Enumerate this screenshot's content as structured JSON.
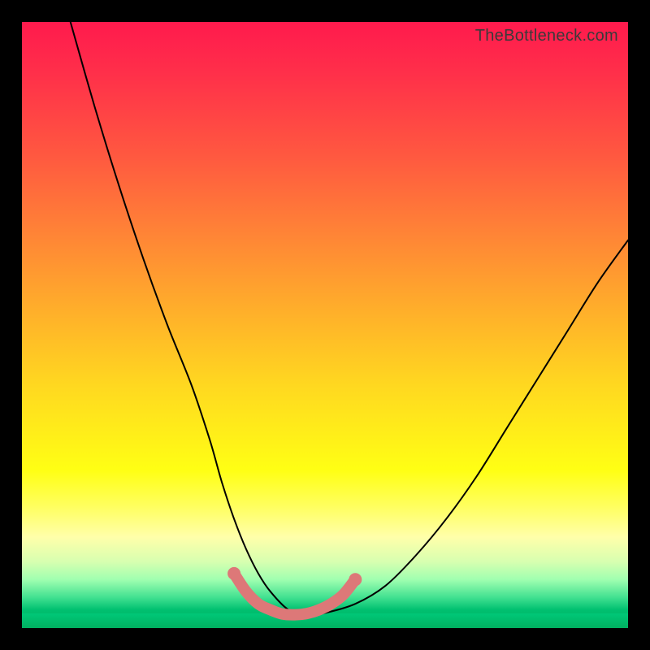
{
  "watermark": "TheBottleneck.com",
  "chart_data": {
    "type": "line",
    "title": "",
    "xlabel": "",
    "ylabel": "",
    "xlim": [
      0,
      100
    ],
    "ylim": [
      0,
      100
    ],
    "grid": false,
    "legend": false,
    "gradient_stops": [
      {
        "pct": 0,
        "color": "#ff1a4d"
      },
      {
        "pct": 22,
        "color": "#ff5840"
      },
      {
        "pct": 48,
        "color": "#ffb02a"
      },
      {
        "pct": 74,
        "color": "#ffff14"
      },
      {
        "pct": 89,
        "color": "#d8ffb0"
      },
      {
        "pct": 100,
        "color": "#00b060"
      }
    ],
    "series": [
      {
        "name": "bottleneck_curve",
        "color": "#000000",
        "x": [
          8,
          12,
          16,
          20,
          24,
          28,
          31,
          33,
          35,
          37,
          39,
          41,
          44,
          47,
          50,
          55,
          60,
          65,
          70,
          75,
          80,
          85,
          90,
          95,
          100
        ],
        "y": [
          100,
          86,
          73,
          61,
          50,
          40,
          31,
          24,
          18,
          13,
          9,
          6,
          3,
          2.2,
          2.5,
          4,
          7,
          12,
          18,
          25,
          33,
          41,
          49,
          57,
          64
        ]
      },
      {
        "name": "optimal_region_overlay",
        "color": "#e07070",
        "x": [
          35,
          37,
          39,
          41,
          43,
          45,
          47,
          49,
          51,
          53,
          55
        ],
        "y": [
          9,
          6,
          4,
          3,
          2.3,
          2.2,
          2.4,
          3,
          4,
          5.5,
          8
        ]
      }
    ],
    "optimal_region": {
      "x_start": 35,
      "x_end": 55,
      "y_min": 2.2
    }
  }
}
